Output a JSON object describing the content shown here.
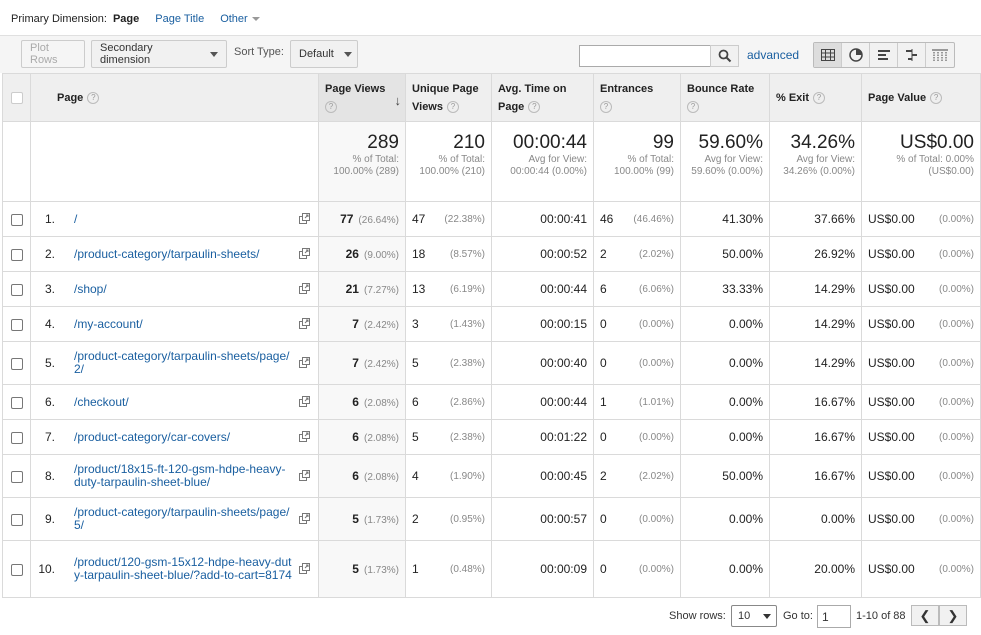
{
  "dimension_bar": {
    "label": "Primary Dimension:",
    "active": "Page",
    "options": [
      "Page Title",
      "Other"
    ]
  },
  "toolbar": {
    "plot_rows": "Plot Rows",
    "secondary_dimension": "Secondary dimension",
    "sort_type_label": "Sort Type:",
    "sort_type_value": "Default",
    "search_placeholder": "",
    "advanced": "advanced",
    "view_icons": [
      "table-view-icon",
      "pie-view-icon",
      "performance-view-icon",
      "comparison-view-icon",
      "pivot-view-icon"
    ]
  },
  "columns": {
    "page": "Page",
    "page_views": "Page Views",
    "unique_page_views": "Unique Page Views",
    "avg_time": "Avg. Time on Page",
    "entrances": "Entrances",
    "bounce_rate": "Bounce Rate",
    "exit": "% Exit",
    "page_value": "Page Value"
  },
  "totals": {
    "page_views": {
      "big": "289",
      "small": "% of Total: 100.00% (289)"
    },
    "unique_page_views": {
      "big": "210",
      "small": "% of Total: 100.00% (210)"
    },
    "avg_time": {
      "big": "00:00:44",
      "small": "Avg for View: 00:00:44 (0.00%)"
    },
    "entrances": {
      "big": "99",
      "small": "% of Total: 100.00% (99)"
    },
    "bounce_rate": {
      "big": "59.60%",
      "small": "Avg for View: 59.60% (0.00%)"
    },
    "exit": {
      "big": "34.26%",
      "small": "Avg for View: 34.26% (0.00%)"
    },
    "page_value": {
      "big": "US$0.00",
      "small": "% of Total: 0.00% (US$0.00)"
    }
  },
  "rows": [
    {
      "idx": "1.",
      "page": "/",
      "pv": "77",
      "pv_pct": "(26.64%)",
      "upv": "47",
      "upv_pct": "(22.38%)",
      "time": "00:00:41",
      "ent": "46",
      "ent_pct": "(46.46%)",
      "bounce": "41.30%",
      "exit": "37.66%",
      "val": "US$0.00",
      "val_pct": "(0.00%)"
    },
    {
      "idx": "2.",
      "page": "/product-category/tarpaulin-sheets/",
      "pv": "26",
      "pv_pct": "(9.00%)",
      "upv": "18",
      "upv_pct": "(8.57%)",
      "time": "00:00:52",
      "ent": "2",
      "ent_pct": "(2.02%)",
      "bounce": "50.00%",
      "exit": "26.92%",
      "val": "US$0.00",
      "val_pct": "(0.00%)"
    },
    {
      "idx": "3.",
      "page": "/shop/",
      "pv": "21",
      "pv_pct": "(7.27%)",
      "upv": "13",
      "upv_pct": "(6.19%)",
      "time": "00:00:44",
      "ent": "6",
      "ent_pct": "(6.06%)",
      "bounce": "33.33%",
      "exit": "14.29%",
      "val": "US$0.00",
      "val_pct": "(0.00%)"
    },
    {
      "idx": "4.",
      "page": "/my-account/",
      "pv": "7",
      "pv_pct": "(2.42%)",
      "upv": "3",
      "upv_pct": "(1.43%)",
      "time": "00:00:15",
      "ent": "0",
      "ent_pct": "(0.00%)",
      "bounce": "0.00%",
      "exit": "14.29%",
      "val": "US$0.00",
      "val_pct": "(0.00%)"
    },
    {
      "idx": "5.",
      "page": "/product-category/tarpaulin-sheets/page/2/",
      "pv": "7",
      "pv_pct": "(2.42%)",
      "upv": "5",
      "upv_pct": "(2.38%)",
      "time": "00:00:40",
      "ent": "0",
      "ent_pct": "(0.00%)",
      "bounce": "0.00%",
      "exit": "14.29%",
      "val": "US$0.00",
      "val_pct": "(0.00%)"
    },
    {
      "idx": "6.",
      "page": "/checkout/",
      "pv": "6",
      "pv_pct": "(2.08%)",
      "upv": "6",
      "upv_pct": "(2.86%)",
      "time": "00:00:44",
      "ent": "1",
      "ent_pct": "(1.01%)",
      "bounce": "0.00%",
      "exit": "16.67%",
      "val": "US$0.00",
      "val_pct": "(0.00%)"
    },
    {
      "idx": "7.",
      "page": "/product-category/car-covers/",
      "pv": "6",
      "pv_pct": "(2.08%)",
      "upv": "5",
      "upv_pct": "(2.38%)",
      "time": "00:01:22",
      "ent": "0",
      "ent_pct": "(0.00%)",
      "bounce": "0.00%",
      "exit": "16.67%",
      "val": "US$0.00",
      "val_pct": "(0.00%)"
    },
    {
      "idx": "8.",
      "page": "/product/18x15-ft-120-gsm-hdpe-heavy-duty-tarpaulin-sheet-blue/",
      "pv": "6",
      "pv_pct": "(2.08%)",
      "upv": "4",
      "upv_pct": "(1.90%)",
      "time": "00:00:45",
      "ent": "2",
      "ent_pct": "(2.02%)",
      "bounce": "50.00%",
      "exit": "16.67%",
      "val": "US$0.00",
      "val_pct": "(0.00%)"
    },
    {
      "idx": "9.",
      "page": "/product-category/tarpaulin-sheets/page/5/",
      "pv": "5",
      "pv_pct": "(1.73%)",
      "upv": "2",
      "upv_pct": "(0.95%)",
      "time": "00:00:57",
      "ent": "0",
      "ent_pct": "(0.00%)",
      "bounce": "0.00%",
      "exit": "0.00%",
      "val": "US$0.00",
      "val_pct": "(0.00%)"
    },
    {
      "idx": "10.",
      "page": "/product/120-gsm-15x12-hdpe-heavy-duty-tarpaulin-sheet-blue/?add-to-cart=8174",
      "pv": "5",
      "pv_pct": "(1.73%)",
      "upv": "1",
      "upv_pct": "(0.48%)",
      "time": "00:00:09",
      "ent": "0",
      "ent_pct": "(0.00%)",
      "bounce": "0.00%",
      "exit": "20.00%",
      "val": "US$0.00",
      "val_pct": "(0.00%)"
    }
  ],
  "footer": {
    "show_rows_label": "Show rows:",
    "show_rows_value": "10",
    "goto_label": "Go to:",
    "goto_value": "1",
    "range": "1-10 of 88"
  }
}
